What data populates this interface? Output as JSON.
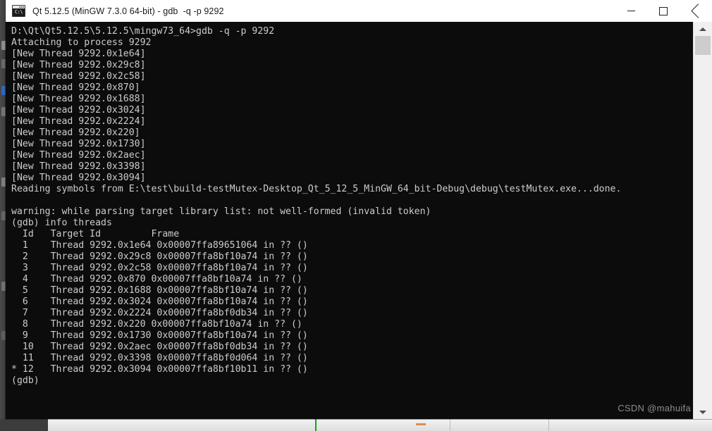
{
  "window": {
    "title": "Qt 5.12.5 (MinGW 7.3.0 64-bit) - gdb  -q -p 9292",
    "icon": "console-icon",
    "icon_text": "C:\\",
    "controls": {
      "minimize": "minimize-button",
      "maximize": "maximize-button",
      "close": "close-button"
    }
  },
  "console": {
    "background_color": "#0c0c0c",
    "text_color": "#cccccc",
    "prompt": "(gdb)",
    "command": "info threads",
    "shell_path": "D:\\Qt\\Qt5.12.5\\5.12.5\\mingw73_64>",
    "shell_command": "gdb -q -p 9292",
    "process_id": "9292",
    "lines": [
      "D:\\Qt\\Qt5.12.5\\5.12.5\\mingw73_64>gdb -q -p 9292",
      "Attaching to process 9292",
      "[New Thread 9292.0x1e64]",
      "[New Thread 9292.0x29c8]",
      "[New Thread 9292.0x2c58]",
      "[New Thread 9292.0x870]",
      "[New Thread 9292.0x1688]",
      "[New Thread 9292.0x3024]",
      "[New Thread 9292.0x2224]",
      "[New Thread 9292.0x220]",
      "[New Thread 9292.0x1730]",
      "[New Thread 9292.0x2aec]",
      "[New Thread 9292.0x3398]",
      "[New Thread 9292.0x3094]",
      "Reading symbols from E:\\test\\build-testMutex-Desktop_Qt_5_12_5_MinGW_64_bit-Debug\\debug\\testMutex.exe...done.",
      "",
      "warning: while parsing target library list: not well-formed (invalid token)",
      "(gdb) info threads",
      "  Id   Target Id         Frame ",
      "  1    Thread 9292.0x1e64 0x00007ffa89651064 in ?? ()",
      "  2    Thread 9292.0x29c8 0x00007ffa8bf10a74 in ?? ()",
      "  3    Thread 9292.0x2c58 0x00007ffa8bf10a74 in ?? ()",
      "  4    Thread 9292.0x870 0x00007ffa8bf10a74 in ?? ()",
      "  5    Thread 9292.0x1688 0x00007ffa8bf10a74 in ?? ()",
      "  6    Thread 9292.0x3024 0x00007ffa8bf10a74 in ?? ()",
      "  7    Thread 9292.0x2224 0x00007ffa8bf0db34 in ?? ()",
      "  8    Thread 9292.0x220 0x00007ffa8bf10a74 in ?? ()",
      "  9    Thread 9292.0x1730 0x00007ffa8bf10a74 in ?? ()",
      "  10   Thread 9292.0x2aec 0x00007ffa8bf0db34 in ?? ()",
      "  11   Thread 9292.0x3398 0x00007ffa8bf0d064 in ?? ()",
      "* 12   Thread 9292.0x3094 0x00007ffa8bf10b11 in ?? ()",
      "(gdb)"
    ],
    "threads_table": {
      "headers": [
        "Id",
        "Target Id",
        "Frame"
      ],
      "current_marker": "*",
      "current_thread_id": "12",
      "rows": [
        {
          "marker": " ",
          "id": "1",
          "target_id": "Thread 9292.0x1e64",
          "frame": "0x00007ffa89651064 in ?? ()"
        },
        {
          "marker": " ",
          "id": "2",
          "target_id": "Thread 9292.0x29c8",
          "frame": "0x00007ffa8bf10a74 in ?? ()"
        },
        {
          "marker": " ",
          "id": "3",
          "target_id": "Thread 9292.0x2c58",
          "frame": "0x00007ffa8bf10a74 in ?? ()"
        },
        {
          "marker": " ",
          "id": "4",
          "target_id": "Thread 9292.0x870",
          "frame": "0x00007ffa8bf10a74 in ?? ()"
        },
        {
          "marker": " ",
          "id": "5",
          "target_id": "Thread 9292.0x1688",
          "frame": "0x00007ffa8bf10a74 in ?? ()"
        },
        {
          "marker": " ",
          "id": "6",
          "target_id": "Thread 9292.0x3024",
          "frame": "0x00007ffa8bf10a74 in ?? ()"
        },
        {
          "marker": " ",
          "id": "7",
          "target_id": "Thread 9292.0x2224",
          "frame": "0x00007ffa8bf0db34 in ?? ()"
        },
        {
          "marker": " ",
          "id": "8",
          "target_id": "Thread 9292.0x220",
          "frame": "0x00007ffa8bf10a74 in ?? ()"
        },
        {
          "marker": " ",
          "id": "9",
          "target_id": "Thread 9292.0x1730",
          "frame": "0x00007ffa8bf10a74 in ?? ()"
        },
        {
          "marker": " ",
          "id": "10",
          "target_id": "Thread 9292.0x2aec",
          "frame": "0x00007ffa8bf0db34 in ?? ()"
        },
        {
          "marker": " ",
          "id": "11",
          "target_id": "Thread 9292.0x3398",
          "frame": "0x00007ffa8bf0d064 in ?? ()"
        },
        {
          "marker": "*",
          "id": "12",
          "target_id": "Thread 9292.0x3094",
          "frame": "0x00007ffa8bf10b11 in ?? ()"
        }
      ]
    }
  },
  "scrollbar": {
    "up_arrow": "scroll-up-arrow-icon",
    "down_arrow": "scroll-down-arrow-icon"
  },
  "watermark": {
    "text": "CSDN @mahuifa"
  }
}
